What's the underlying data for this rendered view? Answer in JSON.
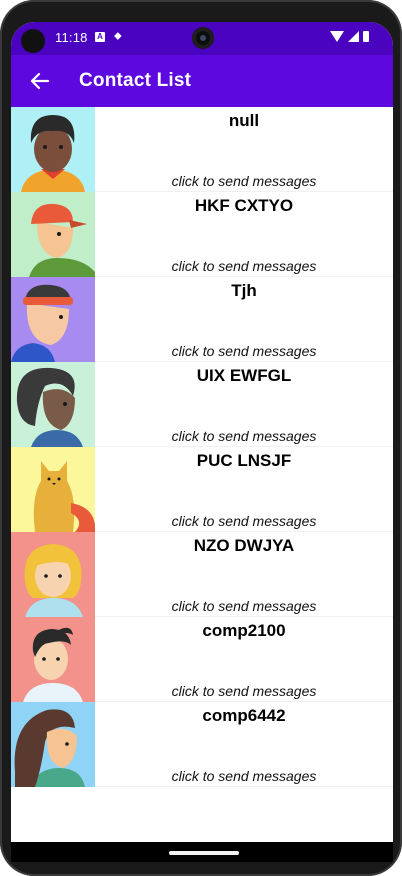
{
  "status": {
    "time": "11:18",
    "a_badge": "A"
  },
  "appbar": {
    "title": "Contact List"
  },
  "contacts": [
    {
      "name": "null",
      "hint": "click to send messages",
      "bg": "#aef0f6"
    },
    {
      "name": "HKF CXTYO",
      "hint": "click to send messages",
      "bg": "#bfeec9"
    },
    {
      "name": "Tjh",
      "hint": "click to send messages",
      "bg": "#a78bf1"
    },
    {
      "name": "UIX EWFGL",
      "hint": "click to send messages",
      "bg": "#c9f1d9"
    },
    {
      "name": "PUC LNSJF",
      "hint": "click to send messages",
      "bg": "#fdf79c"
    },
    {
      "name": "NZO DWJYA",
      "hint": "click to send messages",
      "bg": "#f2928b"
    },
    {
      "name": "comp2100",
      "hint": "click to send messages",
      "bg": "#f2928b"
    },
    {
      "name": "comp6442",
      "hint": "click to send messages",
      "bg": "#8fd3f6"
    }
  ],
  "colors": {
    "statusbar": "#4a04bf",
    "appbar": "#5c08df"
  }
}
